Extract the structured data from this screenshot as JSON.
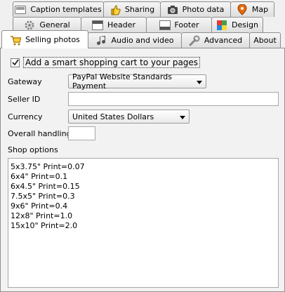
{
  "tabs": {
    "row1": [
      {
        "label": "Caption templates",
        "icon": "caption-templates-icon"
      },
      {
        "label": "Sharing",
        "icon": "thumbs-up-icon"
      },
      {
        "label": "Photo data",
        "icon": "camera-icon"
      },
      {
        "label": "Map",
        "icon": "map-pin-icon"
      }
    ],
    "row2": [
      {
        "label": "General",
        "icon": "gear-icon"
      },
      {
        "label": "Header",
        "icon": "header-icon"
      },
      {
        "label": "Footer",
        "icon": "footer-icon"
      },
      {
        "label": "Design",
        "icon": "palette-icon"
      }
    ],
    "row3": [
      {
        "label": "Selling photos",
        "icon": "shopping-cart-icon"
      },
      {
        "label": "Audio and video",
        "icon": "music-note-icon"
      },
      {
        "label": "Advanced",
        "icon": "wrench-icon"
      },
      {
        "label": "About",
        "icon": ""
      }
    ],
    "active": "Selling photos"
  },
  "form": {
    "smart_cart_label": "Add a smart shopping cart to your pages",
    "smart_cart_checked": true,
    "gateway_label": "Gateway",
    "gateway_value": "PayPal Website Standards Payment",
    "seller_id_label": "Seller ID",
    "seller_id_value": "",
    "currency_label": "Currency",
    "currency_value": "United States Dollars",
    "handling_label": "Overall handling",
    "handling_value": "",
    "shop_options_label": "Shop options",
    "shop_options_lines": [
      "5x3.75\" Print=0.07",
      "6x4\" Print=0.1",
      "6x4.5\" Print=0.15",
      "7.5x5\" Print=0.3",
      "9x6\" Print=0.4",
      "12x8\" Print=1.0",
      "15x10\" Print=2.0"
    ]
  }
}
